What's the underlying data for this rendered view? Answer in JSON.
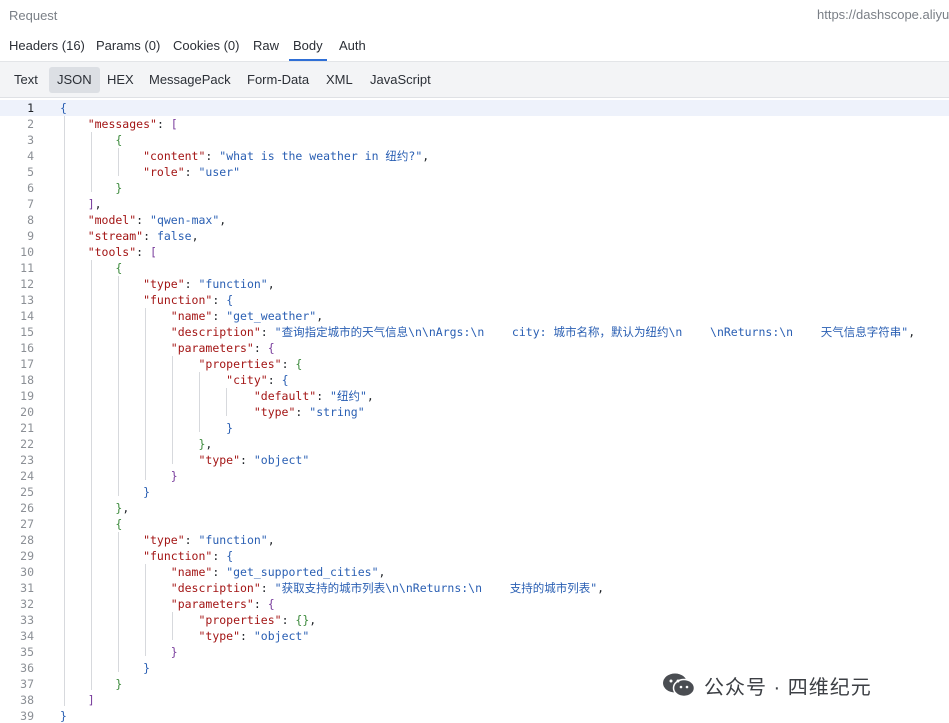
{
  "header": {
    "title": "Request",
    "url": "https://dashscope.aliyu"
  },
  "tabs": [
    {
      "label": "Headers",
      "count": "(16)"
    },
    {
      "label": "Params",
      "count": "(0)"
    },
    {
      "label": "Cookies",
      "count": "(0)"
    },
    {
      "label": "Raw",
      "count": ""
    },
    {
      "label": "Body",
      "count": "",
      "active": true
    },
    {
      "label": "Auth",
      "count": ""
    }
  ],
  "formats": [
    "Text",
    "JSON",
    "HEX",
    "MessagePack",
    "Form-Data",
    "XML",
    "JavaScript"
  ],
  "active_format": "JSON",
  "code_lines": [
    [
      [
        "b1",
        "{"
      ]
    ],
    [
      [
        "k",
        "    \"messages\""
      ],
      [
        "p",
        ": "
      ],
      [
        "b2",
        "["
      ]
    ],
    [
      [
        "b3",
        "        {"
      ]
    ],
    [
      [
        "k",
        "            \"content\""
      ],
      [
        "p",
        ": "
      ],
      [
        "s",
        "\"what is the weather in 纽约?\""
      ],
      [
        "p",
        ","
      ]
    ],
    [
      [
        "k",
        "            \"role\""
      ],
      [
        "p",
        ": "
      ],
      [
        "s",
        "\"user\""
      ]
    ],
    [
      [
        "b3",
        "        }"
      ]
    ],
    [
      [
        "b2",
        "    ]"
      ],
      [
        "p",
        ","
      ]
    ],
    [
      [
        "k",
        "    \"model\""
      ],
      [
        "p",
        ": "
      ],
      [
        "s",
        "\"qwen-max\""
      ],
      [
        "p",
        ","
      ]
    ],
    [
      [
        "k",
        "    \"stream\""
      ],
      [
        "p",
        ": "
      ],
      [
        "b",
        "false"
      ],
      [
        "p",
        ","
      ]
    ],
    [
      [
        "k",
        "    \"tools\""
      ],
      [
        "p",
        ": "
      ],
      [
        "b2",
        "["
      ]
    ],
    [
      [
        "b3",
        "        {"
      ]
    ],
    [
      [
        "k",
        "            \"type\""
      ],
      [
        "p",
        ": "
      ],
      [
        "s",
        "\"function\""
      ],
      [
        "p",
        ","
      ]
    ],
    [
      [
        "k",
        "            \"function\""
      ],
      [
        "p",
        ": "
      ],
      [
        "b1",
        "{"
      ]
    ],
    [
      [
        "k",
        "                \"name\""
      ],
      [
        "p",
        ": "
      ],
      [
        "s",
        "\"get_weather\""
      ],
      [
        "p",
        ","
      ]
    ],
    [
      [
        "k",
        "                \"description\""
      ],
      [
        "p",
        ": "
      ],
      [
        "s",
        "\"查询指定城市的天气信息\\n\\nArgs:\\n    city: 城市名称，默认为纽约\\n    \\nReturns:\\n    天气信息字符串\""
      ],
      [
        "p",
        ","
      ]
    ],
    [
      [
        "k",
        "                \"parameters\""
      ],
      [
        "p",
        ": "
      ],
      [
        "b2",
        "{"
      ]
    ],
    [
      [
        "k",
        "                    \"properties\""
      ],
      [
        "p",
        ": "
      ],
      [
        "b3",
        "{"
      ]
    ],
    [
      [
        "k",
        "                        \"city\""
      ],
      [
        "p",
        ": "
      ],
      [
        "b1",
        "{"
      ]
    ],
    [
      [
        "k",
        "                            \"default\""
      ],
      [
        "p",
        ": "
      ],
      [
        "s",
        "\"纽约\""
      ],
      [
        "p",
        ","
      ]
    ],
    [
      [
        "k",
        "                            \"type\""
      ],
      [
        "p",
        ": "
      ],
      [
        "s",
        "\"string\""
      ]
    ],
    [
      [
        "b1",
        "                        }"
      ]
    ],
    [
      [
        "b3",
        "                    }"
      ],
      [
        "p",
        ","
      ]
    ],
    [
      [
        "k",
        "                    \"type\""
      ],
      [
        "p",
        ": "
      ],
      [
        "s",
        "\"object\""
      ]
    ],
    [
      [
        "b2",
        "                }"
      ]
    ],
    [
      [
        "b1",
        "            }"
      ]
    ],
    [
      [
        "b3",
        "        }"
      ],
      [
        "p",
        ","
      ]
    ],
    [
      [
        "b3",
        "        {"
      ]
    ],
    [
      [
        "k",
        "            \"type\""
      ],
      [
        "p",
        ": "
      ],
      [
        "s",
        "\"function\""
      ],
      [
        "p",
        ","
      ]
    ],
    [
      [
        "k",
        "            \"function\""
      ],
      [
        "p",
        ": "
      ],
      [
        "b1",
        "{"
      ]
    ],
    [
      [
        "k",
        "                \"name\""
      ],
      [
        "p",
        ": "
      ],
      [
        "s",
        "\"get_supported_cities\""
      ],
      [
        "p",
        ","
      ]
    ],
    [
      [
        "k",
        "                \"description\""
      ],
      [
        "p",
        ": "
      ],
      [
        "s",
        "\"获取支持的城市列表\\n\\nReturns:\\n    支持的城市列表\""
      ],
      [
        "p",
        ","
      ]
    ],
    [
      [
        "k",
        "                \"parameters\""
      ],
      [
        "p",
        ": "
      ],
      [
        "b2",
        "{"
      ]
    ],
    [
      [
        "k",
        "                    \"properties\""
      ],
      [
        "p",
        ": "
      ],
      [
        "b3",
        "{}"
      ],
      [
        "p",
        ","
      ]
    ],
    [
      [
        "k",
        "                    \"type\""
      ],
      [
        "p",
        ": "
      ],
      [
        "s",
        "\"object\""
      ]
    ],
    [
      [
        "b2",
        "                }"
      ]
    ],
    [
      [
        "b1",
        "            }"
      ]
    ],
    [
      [
        "b3",
        "        }"
      ]
    ],
    [
      [
        "b2",
        "    ]"
      ]
    ],
    [
      [
        "b1",
        "}"
      ]
    ]
  ],
  "current_line": 1,
  "watermark": "公众号 · 四维纪元"
}
